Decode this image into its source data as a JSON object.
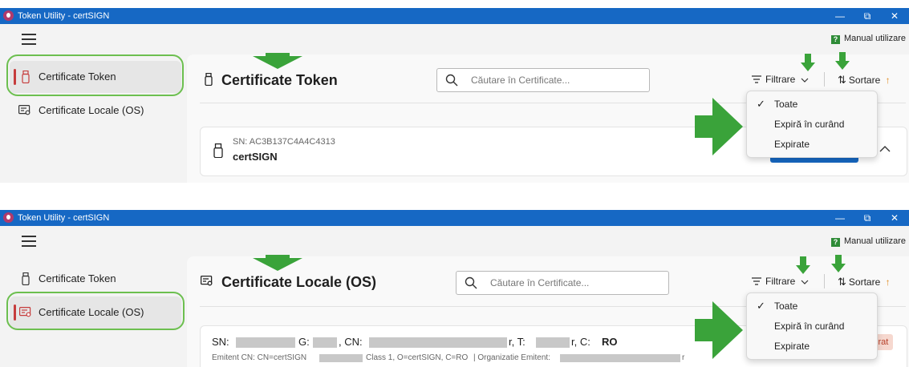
{
  "app_title": "Token Utility - certSIGN",
  "window_controls": {
    "minimize": "—",
    "maximize": "⧉",
    "close": "✕"
  },
  "manual_label": "Manual utilizare",
  "nav": {
    "token_label": "Certificate Token",
    "local_label": "Certificate Locale (OS)"
  },
  "search_placeholder": "Căutare în Certificate...",
  "toolbar": {
    "filter_label": "Filtrare",
    "sort_label": "Sortare"
  },
  "filter_menu": {
    "all": "Toate",
    "expiring": "Expiră în curând",
    "expired": "Expirate"
  },
  "top": {
    "page_title": "Certificate Token",
    "card": {
      "sn": "SN: AC3B137C4A4C4313",
      "name": "certSIGN"
    }
  },
  "bottom": {
    "page_title": "Certificate Locale (OS)",
    "card": {
      "sn_prefix": "SN:",
      "g_label": "G:",
      "cn_label": ", CN:",
      "t_label": "r, T:",
      "c_label": "r, C:",
      "c_value": "RO",
      "issuer_prefix": "Emitent CN: CN=certSIGN",
      "issuer_mid": "Class 1, O=certSIGN, C=RO",
      "issuer_org": "| Organizatie Emitent:",
      "issuer_end": "r",
      "badge": "irat"
    }
  },
  "colors": {
    "titlebar": "#1668c4",
    "accent_red": "#c63c3c",
    "highlight_green": "#2e9e2e",
    "action_blue": "#1668c4"
  }
}
